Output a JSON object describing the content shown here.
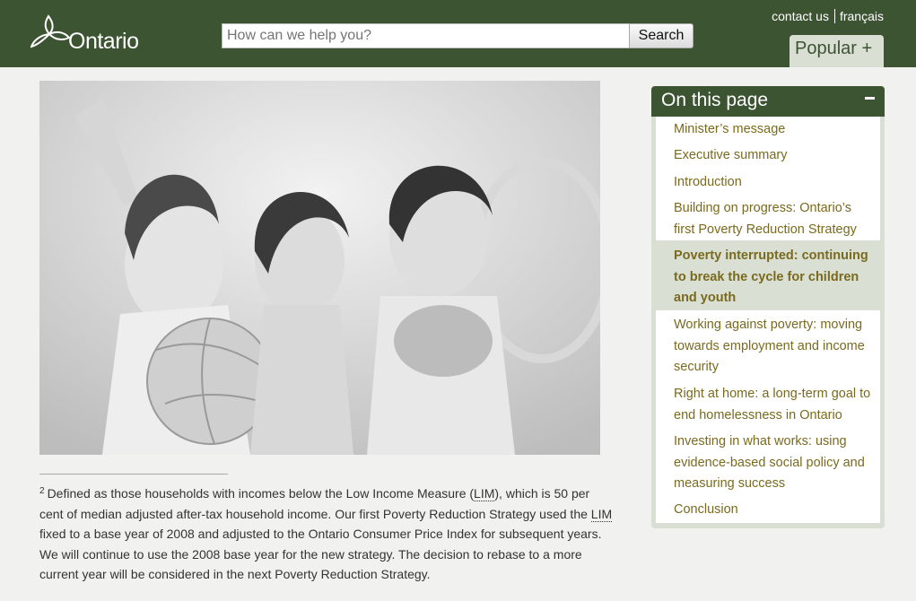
{
  "header": {
    "logo_text": "Ontario",
    "search_placeholder": "How can we help you?",
    "search_button": "Search",
    "contact_us": "contact us",
    "francais": "français",
    "popular": "Popular +"
  },
  "photo": {
    "alt": "Three smiling children sitting together, one holding a ball"
  },
  "footnote": {
    "number": "2",
    "text_1": "Defined as those households with incomes below the Low Income Measure (",
    "abbr_1": "LIM",
    "text_2": "), which is 50 per cent of median adjusted after-tax household income. Our first Poverty Reduction Strategy used the ",
    "abbr_2": "LIM",
    "text_3": " fixed to a base year of 2008 and adjusted to the Ontario Consumer Price Index for subsequent years. We will continue to use the 2008 base year for the new strategy. The decision to rebase to a more current year will be considered in the next Poverty Reduction Strategy."
  },
  "sidebar": {
    "title": "On this page",
    "items": [
      {
        "label": "Minister’s message"
      },
      {
        "label": "Executive summary"
      },
      {
        "label": "Introduction"
      },
      {
        "label": "Building on progress: Ontario’s first Poverty Reduction Strategy"
      },
      {
        "label": "Poverty interrupted: continuing to break the cycle for children and youth",
        "active": true
      },
      {
        "label": "Working against poverty: moving towards employment and income security"
      },
      {
        "label": "Right at home: a long-term goal to end homelessness in Ontario"
      },
      {
        "label": "Investing in what works: using evidence-based social policy and measuring success"
      },
      {
        "label": "Conclusion"
      }
    ]
  }
}
